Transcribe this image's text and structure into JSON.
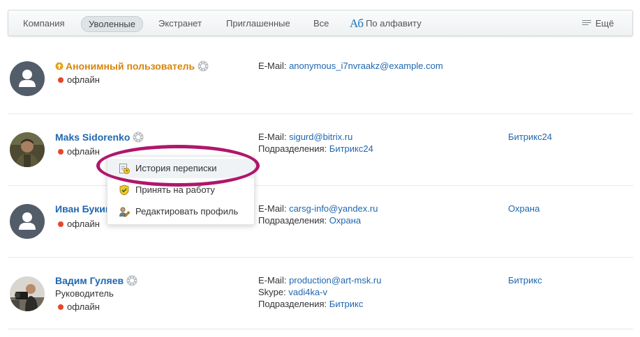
{
  "filter": {
    "tabs": [
      {
        "label": "Компания"
      },
      {
        "label": "Уволенные"
      },
      {
        "label": "Экстранет"
      },
      {
        "label": "Приглашенные"
      },
      {
        "label": "Все"
      }
    ],
    "alpha_glyph": "Аб",
    "alpha_label": "По алфавиту",
    "more_label": "Ещё"
  },
  "users": [
    {
      "name": "Анонимный пользователь",
      "status": "офлайн",
      "email_label": "E-Mail:",
      "email": "anonymous_i7nvraakz@example.com"
    },
    {
      "name": "Maks Sidorenko",
      "status": "офлайн",
      "email_label": "E-Mail:",
      "email": "sigurd@bitrix.ru",
      "dept_label": "Подразделения:",
      "dept_value": "Битрикс24",
      "dept_right": "Битрикс24"
    },
    {
      "name": "Иван Букин",
      "status": "офлайн",
      "email_label": "E-Mail:",
      "email": "carsg-info@yandex.ru",
      "dept_label": "Подразделения:",
      "dept_value": "Охрана",
      "dept_right": "Охрана"
    },
    {
      "name": "Вадим Гуляев",
      "position": "Руководитель",
      "status": "офлайн",
      "email_label": "E-Mail:",
      "email": "production@art-msk.ru",
      "skype_label": "Skype:",
      "skype": "vadi4ka-v",
      "dept_label": "Подразделения:",
      "dept_value": "Битрикс",
      "dept_right": "Битрикс"
    }
  ],
  "popup_menu": [
    {
      "label": "История переписки",
      "icon": "chat-history-icon"
    },
    {
      "label": "Принять на работу",
      "icon": "shield-icon"
    },
    {
      "label": "Редактировать профиль",
      "icon": "edit-profile-icon"
    }
  ],
  "colors": {
    "link": "#2067b0",
    "guest_name": "#d7860a",
    "offline_dot": "#e8452b",
    "highlight": "#b0166c"
  }
}
